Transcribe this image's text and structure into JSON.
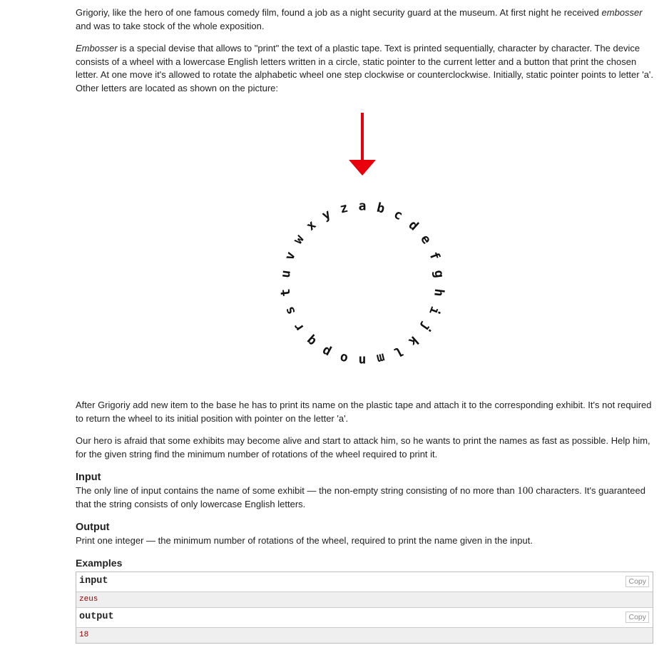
{
  "statement": {
    "p1_a": "Grigoriy, like the hero of one famous comedy film, found a job as a night security guard at the museum. At first night he received ",
    "p1_em": "embosser",
    "p1_b": " and was to take stock of the whole exposition.",
    "p2_em": "Embosser",
    "p2_b": " is a special devise that allows to \"print\" the text of a plastic tape. Text is printed sequentially, character by character. The device consists of a wheel with a lowercase English letters written in a circle, static pointer to the current letter and a button that print the chosen letter. At one move it's allowed to rotate the alphabetic wheel one step clockwise or counterclockwise. Initially, static pointer points to letter 'a'. Other letters are located as shown on the picture:",
    "p3": "After Grigoriy add new item to the base he has to print its name on the plastic tape and attach it to the corresponding exhibit. It's not required to return the wheel to its initial position with pointer on the letter 'a'.",
    "p4": "Our hero is afraid that some exhibits may become alive and start to attack him, so he wants to print the names as fast as possible. Help him, for the given string find the minimum number of rotations of the wheel required to print it."
  },
  "input_section": {
    "title": "Input",
    "text_a": "The only line of input contains the name of some exhibit — the non-empty string consisting of no more than ",
    "num": "100",
    "text_b": " characters. It's guaranteed that the string consists of only lowercase English letters."
  },
  "output_section": {
    "title": "Output",
    "text": "Print one integer — the minimum number of rotations of the wheel, required to print the name given in the input."
  },
  "examples": {
    "title": "Examples",
    "input_label": "input",
    "input_value": "zeus",
    "output_label": "output",
    "output_value": "18",
    "copy_label": "Copy"
  },
  "wheel": {
    "letters": [
      "a",
      "b",
      "c",
      "d",
      "e",
      "f",
      "g",
      "h",
      "i",
      "j",
      "k",
      "l",
      "m",
      "n",
      "o",
      "p",
      "q",
      "r",
      "s",
      "t",
      "u",
      "v",
      "w",
      "x",
      "y",
      "z"
    ],
    "pointer_color": "#e8000b",
    "letter_color": "#111111"
  }
}
